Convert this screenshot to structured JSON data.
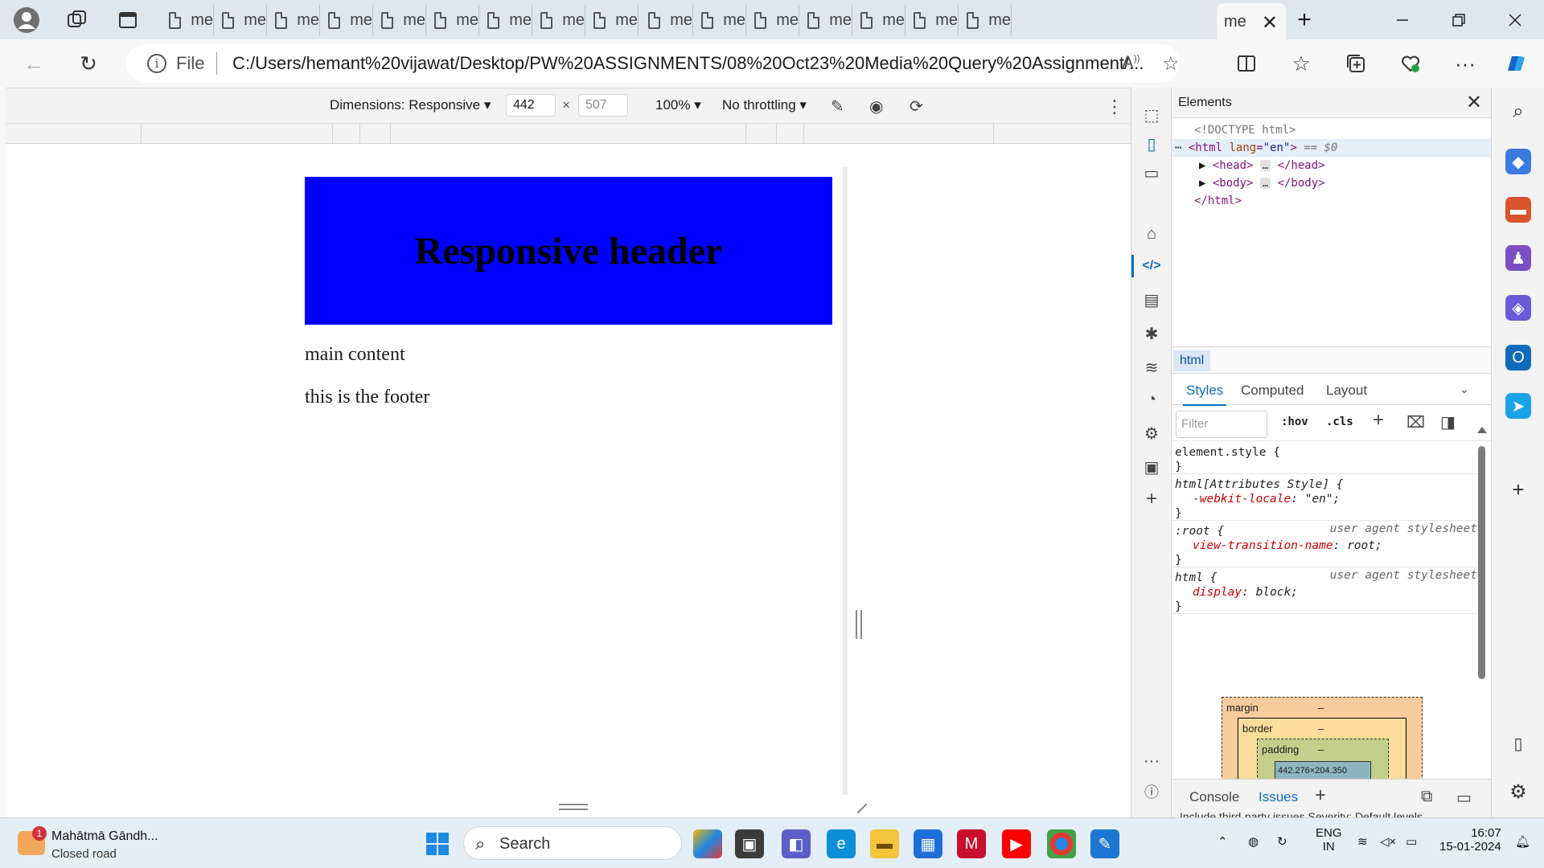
{
  "browser": {
    "tab_short_label": "me",
    "inactive_tab_count": 16,
    "active_tab_label": "me",
    "new_tab_symbol": "+",
    "address": {
      "scheme_label": "File",
      "url": "C:/Users/hemant%20vijawat/Desktop/PW%20ASSIGNMENTS/08%20Oct23%20Media%20Query%20Assignment/..."
    }
  },
  "device_toolbar": {
    "dimensions_label": "Dimensions: Responsive",
    "width_value": "442",
    "height_value": "507",
    "times_symbol": "×",
    "zoom_label": "100%",
    "throttling_label": "No throttling"
  },
  "page": {
    "header_text": "Responsive header",
    "main_text": "main content",
    "footer_text": "this is the footer",
    "header_color": "#0000ff"
  },
  "devtools": {
    "panel_title": "Elements",
    "dom": {
      "doctype": "<!DOCTYPE html>",
      "html_open_tag": "<html",
      "html_attr_name": "lang",
      "html_attr_value": "\"en\"",
      "html_open_close": ">",
      "selected_marker": "== $0",
      "head_open": "<head>",
      "head_close": "</head>",
      "body_open": "<body>",
      "body_close": "</body>",
      "html_close": "</html>",
      "ellipsis": "…"
    },
    "breadcrumb": "html",
    "styles_tabs": [
      "Styles",
      "Computed",
      "Layout"
    ],
    "filter_placeholder": "Filter",
    "hov_label": ":hov",
    "cls_label": ".cls",
    "rules": {
      "r1_selector": "element.style {",
      "r1_close": "}",
      "r2_selector": "html[Attributes Style] {",
      "r2_prop": "-webkit-locale",
      "r2_value": "\"en\";",
      "r2_close": "}",
      "r3_selector": ":root {",
      "r3_source": "user agent stylesheet",
      "r3_prop": "view-transition-name",
      "r3_value": "root;",
      "r3_close": "}",
      "r4_selector": "html {",
      "r4_source": "user agent stylesheet",
      "r4_prop": "display",
      "r4_value": "block;",
      "r4_close": "}"
    },
    "box_model": {
      "margin_label": "margin",
      "margin_value": "–",
      "border_label": "border",
      "border_value": "–",
      "padding_label": "padding",
      "padding_value": "–",
      "content_value": "442.276×204.350"
    },
    "drawer_tabs": [
      "Console",
      "Issues"
    ],
    "drawer_peek": "Include third-party issues    Severity: Default levels"
  },
  "taskbar": {
    "weather_badge": "1",
    "weather_title": "Mahātmā Gāndh...",
    "weather_subtitle": "Closed road",
    "search_label": "Search",
    "lang_line1": "ENG",
    "lang_line2": "IN",
    "time": "16:07",
    "date": "15-01-2024"
  }
}
